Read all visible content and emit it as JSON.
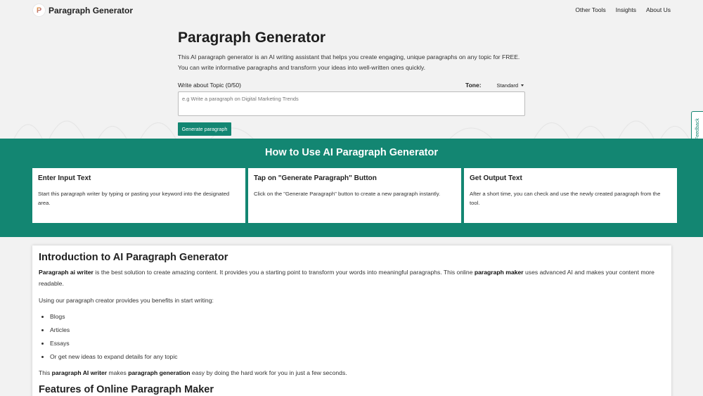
{
  "header": {
    "brand": "Paragraph Generator",
    "logo_letter": "P",
    "nav": [
      "Other Tools",
      "Insights",
      "About Us"
    ]
  },
  "hero": {
    "title": "Paragraph Generator",
    "description": "This AI paragraph generator is an AI writing assistant that helps you create engaging, unique paragraphs on any topic for FREE. You can write informative paragraphs and transform your ideas into well-written ones quickly.",
    "topic_label": "Write about Topic (0/50)",
    "tone_label": "Tone:",
    "tone_value": "Standard",
    "input_placeholder": "e.g Write a paragraph on Digital Marketing Trends",
    "button": "Generate paragraph"
  },
  "feedback": "Feedback",
  "howto": {
    "title": "How to Use AI Paragraph Generator",
    "cards": [
      {
        "title": "Enter Input Text",
        "text": "Start this paragraph writer by typing or pasting your keyword into the designated area."
      },
      {
        "title": "Tap on \"Generate Paragraph\" Button",
        "text": "Click on the \"Generate Paragraph\" button to create a new paragraph instantly."
      },
      {
        "title": "Get Output Text",
        "text": "After a short time, you can check and use the newly created paragraph from the tool."
      }
    ]
  },
  "content": {
    "title": "Introduction to AI Paragraph Generator",
    "p1_b1": "Paragraph ai writer",
    "p1_t1": " is the best solution to create amazing content. It provides you a starting point to transform your words into meaningful paragraphs. This online ",
    "p1_b2": "paragraph maker",
    "p1_t2": " uses advanced AI and makes your content more readable.",
    "p2": "Using our paragraph creator provides you benefits in start writing:",
    "list": [
      "Blogs",
      "Articles",
      "Essays",
      "Or get new ideas to expand details for any topic"
    ],
    "p3_t1": "This ",
    "p3_b1": "paragraph AI writer",
    "p3_t2": " makes ",
    "p3_b2": "paragraph generation",
    "p3_t3": " easy by doing the hard work for you in just a few seconds.",
    "title2": "Features of Online Paragraph Maker"
  },
  "colors": {
    "accent": "#138672",
    "background": "#f2f2f2"
  }
}
